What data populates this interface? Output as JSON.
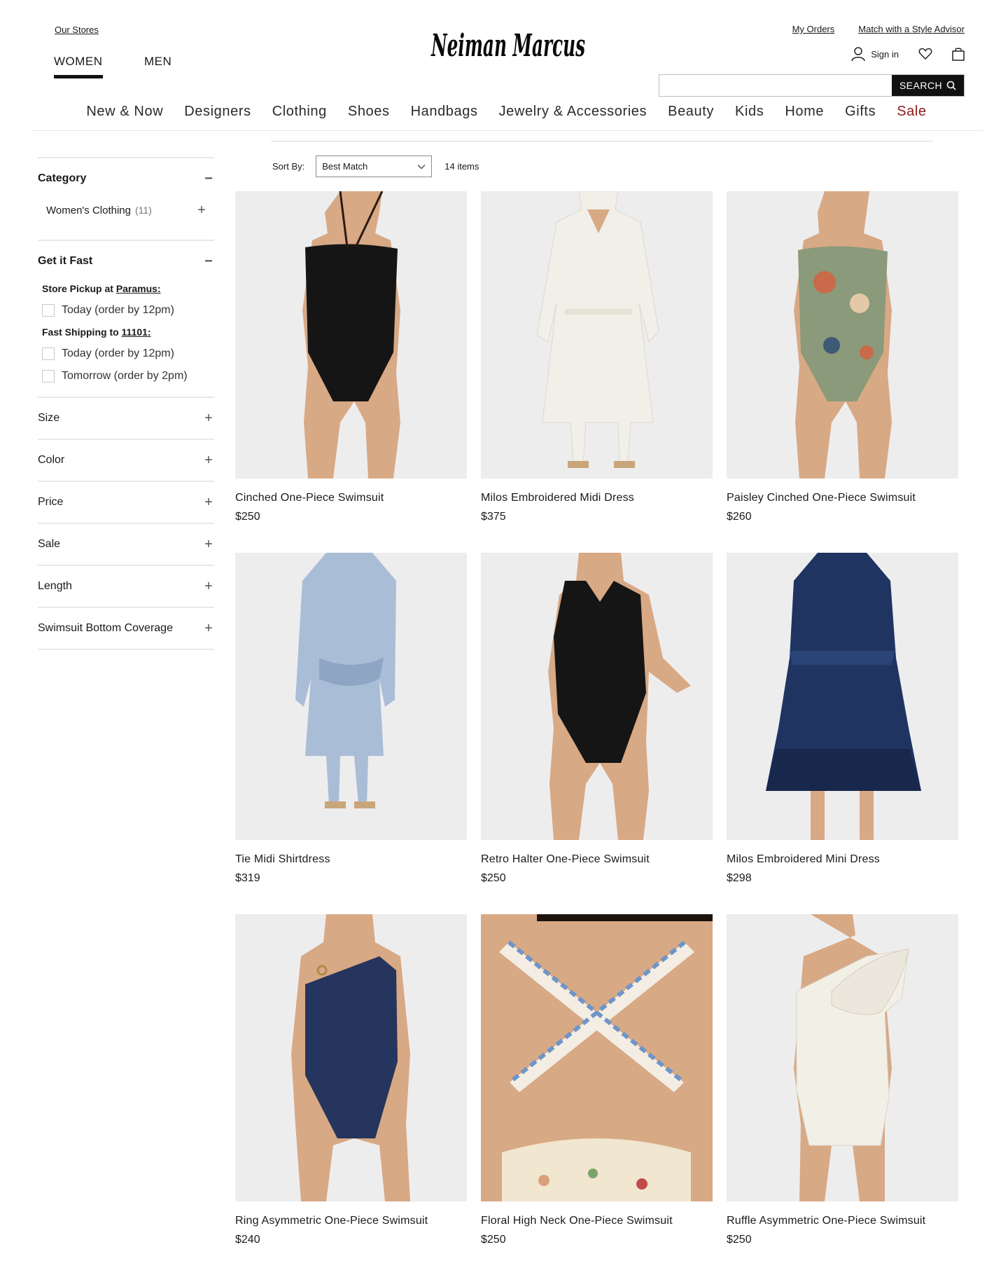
{
  "header": {
    "our_stores": "Our Stores",
    "tabs": [
      {
        "label": "WOMEN"
      },
      {
        "label": "MEN"
      }
    ],
    "logo_text": "Neiman Marcus",
    "my_orders": "My Orders",
    "style_advisor": "Match with a Style Advisor",
    "sign_in": "Sign in",
    "search": {
      "value": "",
      "button_label": "SEARCH"
    }
  },
  "nav": [
    {
      "label": "New & Now"
    },
    {
      "label": "Designers"
    },
    {
      "label": "Clothing"
    },
    {
      "label": "Shoes"
    },
    {
      "label": "Handbags"
    },
    {
      "label": "Jewelry & Accessories"
    },
    {
      "label": "Beauty"
    },
    {
      "label": "Kids"
    },
    {
      "label": "Home"
    },
    {
      "label": "Gifts"
    },
    {
      "label": "Sale"
    }
  ],
  "sidebar": {
    "category": {
      "title": "Category",
      "toggle": "−",
      "item_label": "Women's Clothing",
      "item_count": "(11)",
      "item_toggle": "+"
    },
    "get_it_fast": {
      "title": "Get it Fast",
      "toggle": "−",
      "pickup_prefix": "Store Pickup at",
      "pickup_store": "Paramus:",
      "pickup_options": [
        "Today (order by 12pm)"
      ],
      "shipping_prefix": "Fast Shipping to",
      "shipping_zip": "11101:",
      "shipping_options": [
        "Today (order by 12pm)",
        "Tomorrow (order by 2pm)"
      ]
    },
    "facets": [
      {
        "label": "Size"
      },
      {
        "label": "Color"
      },
      {
        "label": "Price"
      },
      {
        "label": "Sale"
      },
      {
        "label": "Length"
      },
      {
        "label": "Swimsuit Bottom Coverage"
      }
    ],
    "facet_toggle": "+"
  },
  "results": {
    "sort_label": "Sort By:",
    "sort_value": "Best Match",
    "items_count": "14 items"
  },
  "products": [
    {
      "name": "Cinched One-Piece Swimsuit",
      "price": "$250",
      "color": "#151515"
    },
    {
      "name": "Milos Embroidered Midi Dress",
      "price": "$375",
      "color": "#f1efe8"
    },
    {
      "name": "Paisley Cinched One-Piece Swimsuit",
      "price": "$260",
      "color": "#8a9a7a"
    },
    {
      "name": "Tie Midi Shirtdress",
      "price": "$319",
      "color": "#a9bdd6"
    },
    {
      "name": "Retro Halter One-Piece Swimsuit",
      "price": "$250",
      "color": "#151515"
    },
    {
      "name": "Milos Embroidered Mini Dress",
      "price": "$298",
      "color": "#1f3461"
    },
    {
      "name": "Ring Asymmetric One-Piece Swimsuit",
      "price": "$240",
      "color": "#25355d"
    },
    {
      "name": "Floral High Neck One-Piece Swimsuit",
      "price": "$250",
      "color": "#d9a07a"
    },
    {
      "name": "Ruffle Asymmetric One-Piece Swimsuit",
      "price": "$250",
      "color": "#f2efe7"
    }
  ],
  "colors": {
    "sale_accent": "#8b1a1a",
    "search_button": "#111111",
    "image_bg": "#eeedee",
    "skin": "#d8a985"
  }
}
